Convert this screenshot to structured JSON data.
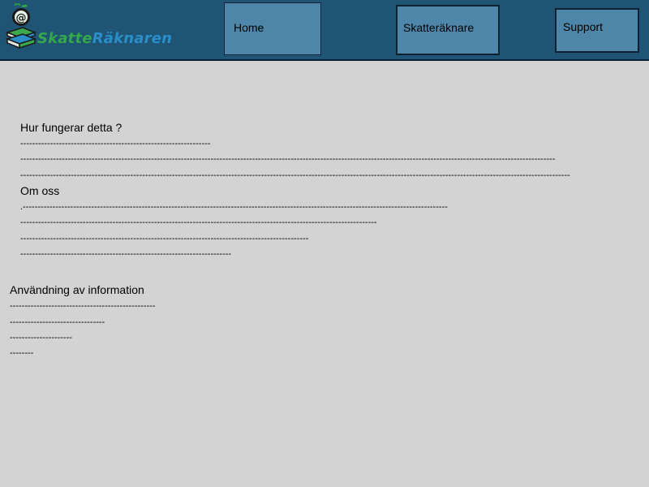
{
  "header": {
    "logo": {
      "text_part1": "Skatte",
      "text_part2": "Räknaren",
      "at_symbol": "@",
      "icon": "books-at-icon"
    },
    "nav": {
      "home": "Home",
      "calculator": "Skatteräknare",
      "support": "Support"
    }
  },
  "content": {
    "section1": {
      "heading": "Hur fungerar detta ?",
      "lines": [
        "----------------------------------------------------------------",
        "------------------------------------------------------------------------------------------------------------------------------------------------------------------------------------",
        "-----------------------------------------------------------------------------------------------------------------------------------------------------------------------------------------"
      ]
    },
    "section2": {
      "heading": "Om oss",
      "lines": [
        ".-----------------------------------------------------------------------------------------------------------------------------------------------",
        "------------------------------------------------------------------------------------------------------------------------",
        "-------------------------------------------------------------------------------------------------",
        "-----------------------------------------------------------------------"
      ]
    },
    "section3": {
      "heading": "Användning av information",
      "lines": [
        "-------------------------------------------------",
        "--------------------------------",
        "---------------------",
        "--------"
      ]
    }
  },
  "colors": {
    "header_bg": "#1f5475",
    "button_bg": "#4d86a8",
    "page_bg": "#d3d3d3",
    "logo_green": "#35a84a",
    "logo_blue": "#2a8fc9"
  }
}
